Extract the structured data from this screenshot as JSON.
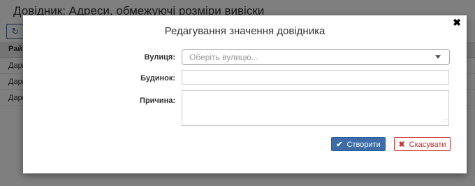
{
  "background": {
    "page_title": "Довідник: Адреси, обмежуючі розміри вивіски",
    "refresh_icon": "refresh-icon",
    "table": {
      "header": "Рай",
      "rows": [
        "Дарн",
        "Дарн",
        "Дарн"
      ]
    }
  },
  "modal": {
    "title": "Редагування значення довідника",
    "close_icon": "close-icon",
    "fields": {
      "street_label": "Вулиця:",
      "street_placeholder": "Оберіть вулицю...",
      "building_label": "Будинок:",
      "building_value": "",
      "reason_label": "Причина:",
      "reason_value": ""
    },
    "buttons": {
      "create_label": "Створити",
      "cancel_label": "Скасувати"
    }
  },
  "colors": {
    "primary": "#3d6ca8",
    "danger": "#c9302c"
  }
}
